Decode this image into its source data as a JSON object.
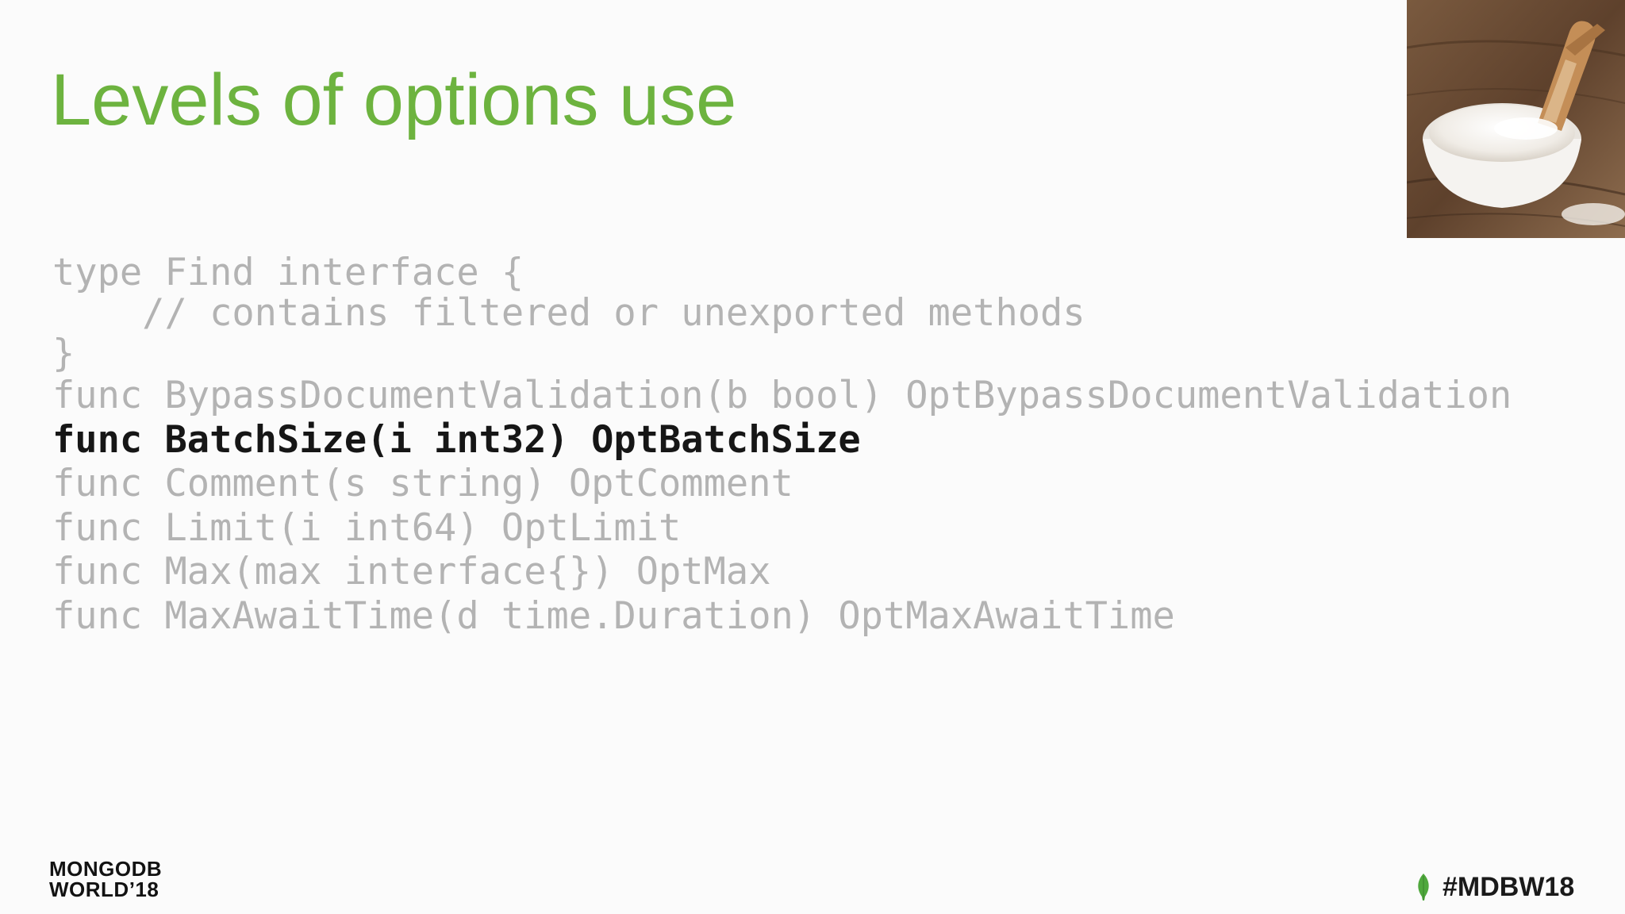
{
  "slide": {
    "title": "Levels of options use",
    "code_lines": [
      "type Find interface {",
      "    // contains filtered or unexported methods",
      "}",
      "func BypassDocumentValidation(b bool) OptBypassDocumentValidation",
      "func BatchSize(i int32) OptBatchSize",
      "func Comment(s string) OptComment",
      "func Limit(i int64) OptLimit",
      "func Max(max interface{}) OptMax",
      "func MaxAwaitTime(d time.Duration) OptMaxAwaitTime"
    ],
    "highlighted_line": "func BatchSize(i int32) OptBatchSize",
    "photo_icon": "salt-bowl-with-wooden-scoop-photo"
  },
  "footer": {
    "logo_line1": "MONGODB",
    "logo_line2": "WORLD’18",
    "hashtag": "#MDBW18",
    "hashtag_icon": "mongodb-leaf-icon"
  },
  "colors": {
    "title": "#6db33f",
    "code_dim": "#b3b3b3",
    "code_highlight": "#161616",
    "leaf": "#4fa83d",
    "background": "#fbfbfb"
  }
}
